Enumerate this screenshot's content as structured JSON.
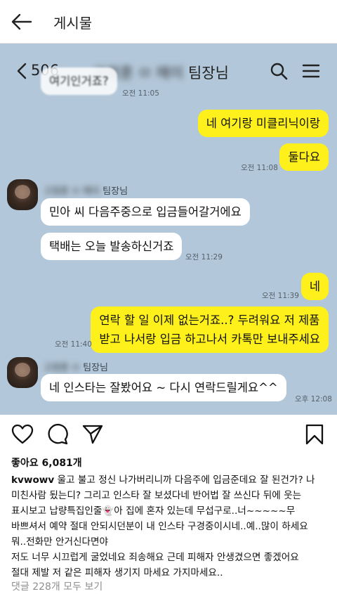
{
  "ig_header": {
    "title": "게시물"
  },
  "chat": {
    "count": "506",
    "partner_blurred": "고정훈 ㅁ 매이",
    "partner_suffix": " 팀장님",
    "top_cut_text": "여기인거죠?",
    "messages": [
      {
        "side": "left",
        "text": "여기인거죠?",
        "time": "오전 11:05"
      },
      {
        "side": "right",
        "text": "네 여기랑 미클리닉이랑"
      },
      {
        "side": "right",
        "text": "둘다요",
        "time": "오전 11:08"
      },
      {
        "side": "left",
        "sender_blurred": "고정훈 ㅁ 매이",
        "sender_suffix": " 팀장님",
        "text": "민아 씨 다음주중으로 입금들어갈거에요"
      },
      {
        "side": "left",
        "text": "택배는 오늘 발송하신거죠",
        "time": "오전 11:29"
      },
      {
        "side": "right",
        "text": "네",
        "time": "오전 11:39"
      },
      {
        "side": "right",
        "lines": [
          "연락 할 일 이제 없는거죠..? 두려워요 저 제품",
          "받고 나서랑 입금 하고나서 카톡만 보내주세요"
        ],
        "time": "오전 11:40"
      },
      {
        "side": "left",
        "sender_blurred": "고정훈 ㅁ",
        "sender_suffix": " 팀장님",
        "text": "네 인스타는 잘봤어요 ~ 다시 연락드릴게요^^",
        "time": "오후 12:08"
      }
    ]
  },
  "post": {
    "likes": "좋아요 6,081개",
    "username": "kvwowv",
    "caption_lines": [
      " 울고 불고 정신 나가버리니까 다음주에 입금준데요 잘 된건가? 나",
      "미친사람 됬는디? 그리고 인스타 잘 보셨다네 반어법 잘 쓰신다 뒤에 웃는",
      "표시보고 납량특집인줄👻아 집에 혼자 있는데 무섭구로..너~~~~~무",
      "바쁘셔서 예약 절대 안되시던분이 내 인스타 구경중이시네..예..많이 하세요",
      "뭐..전화만 안거신다면야",
      "저도 너무 시끄럽게 굴었네요 죄송해요 근데 피해자 안생겼으면 좋겠어요",
      "절대 제발 저 같은 피해자 생기지 마세요 가지마세요.."
    ],
    "comments_link": "댓글 228개 모두 보기"
  },
  "icons": {
    "back": "arrow-left-icon",
    "kakao_back": "chevron-left-icon",
    "search": "search-icon",
    "menu": "hamburger-menu-icon",
    "like": "heart-icon",
    "comment": "comment-icon",
    "share": "send-icon",
    "save": "bookmark-icon"
  },
  "colors": {
    "kakao_bg": "#b2c7d9",
    "kakao_yellow": "#fef01b"
  }
}
